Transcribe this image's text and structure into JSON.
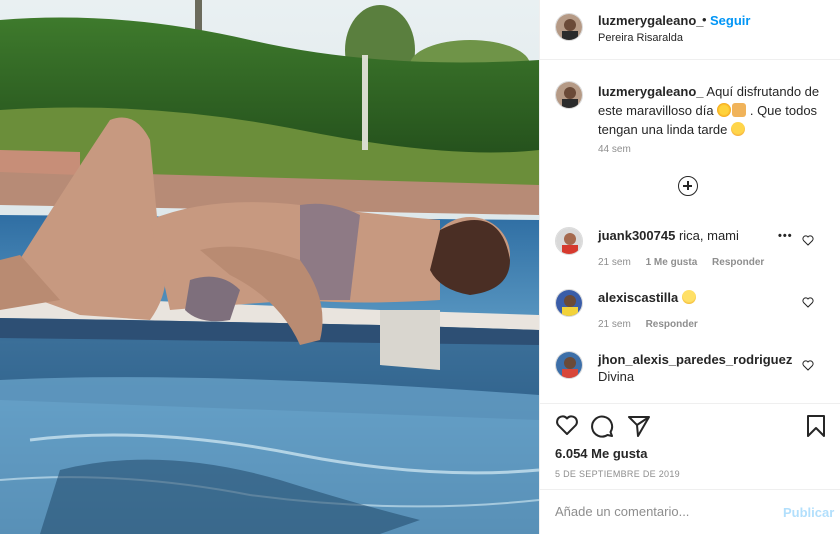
{
  "post": {
    "header": {
      "username": "luzmerygaleano_",
      "separator": "•",
      "follow_label": "Seguir",
      "location": "Pereira Risaralda",
      "more_label": "•••"
    },
    "caption": {
      "username": "luzmerygaleano_",
      "text_1": " Aquí disfrutando de este maravilloso día ",
      "text_2": " . Que todos tengan una linda tarde ",
      "emojis": [
        "sun-emoji",
        "praying-hands-emoji",
        "hug-emoji"
      ],
      "time": "44 sem"
    },
    "load_more_icon": "plus-circle-icon",
    "comments": [
      {
        "username": "juank300745",
        "text": " rica, mami",
        "time": "21 sem",
        "likes": "1 Me gusta",
        "reply": "Responder",
        "more": "•••"
      },
      {
        "username": "alexiscastilla",
        "text": " ",
        "emoji": "smiling-face-emoji",
        "time": "21 sem",
        "reply": "Responder"
      },
      {
        "username": "jhon_alexis_paredes_rodriguez",
        "text": "Divina"
      }
    ],
    "actions": {
      "icons": [
        "heart-icon",
        "comment-icon",
        "share-icon",
        "bookmark-icon"
      ],
      "likes": "6.054 Me gusta",
      "date": "5 DE SEPTIEMBRE DE 2019"
    },
    "add_comment": {
      "placeholder": "Añade un comentario...",
      "publish_label": "Publicar"
    },
    "colors": {
      "link_blue": "#0095f6",
      "publish_disabled": "#b2dffc",
      "muted_text": "#8e8e8e",
      "divider": "#efefef"
    }
  }
}
